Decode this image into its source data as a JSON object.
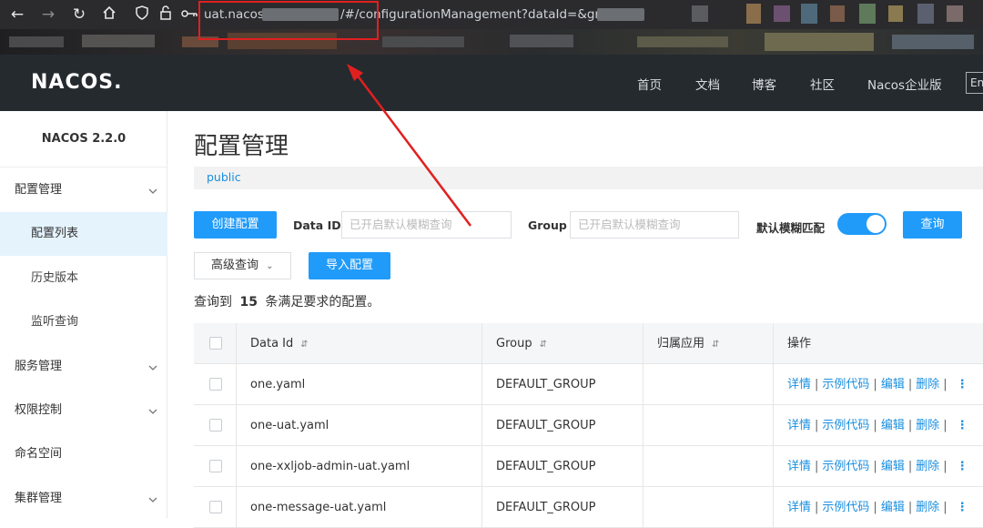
{
  "browser": {
    "url_prefix": "uat.nacos",
    "url_suffix": "/#/configurationManagement?dataId=&grou"
  },
  "header": {
    "logo": "NACOS.",
    "nav": [
      "首页",
      "文档",
      "博客",
      "社区",
      "Nacos企业版"
    ],
    "lang": "En"
  },
  "sidebar": {
    "version": "NACOS 2.2.0",
    "groups": {
      "config": "配置管理",
      "service": "服务管理",
      "auth": "权限控制",
      "namespace": "命名空间",
      "cluster": "集群管理"
    },
    "sub": {
      "list": "配置列表",
      "history": "历史版本",
      "listen": "监听查询"
    }
  },
  "main": {
    "title": "配置管理",
    "namespace": "public",
    "create_label": "创建配置",
    "dataid_label": "Data ID",
    "dataid_placeholder": "已开启默认模糊查询",
    "group_label": "Group",
    "group_placeholder": "已开启默认模糊查询",
    "fuzzy_label": "默认模糊匹配",
    "fuzzy_on": true,
    "search_label": "查询",
    "advanced_label": "高级查询",
    "import_label": "导入配置",
    "result_prefix": "查询到",
    "result_count": "15",
    "result_suffix": "条满足要求的配置。"
  },
  "table": {
    "headers": {
      "dataid": "Data Id",
      "group": "Group",
      "app": "归属应用",
      "ops": "操作"
    },
    "ops": {
      "detail": "详情",
      "sample": "示例代码",
      "edit": "编辑",
      "delete": "删除"
    },
    "rows": [
      {
        "dataid": "one.yaml",
        "group": "DEFAULT_GROUP",
        "app": ""
      },
      {
        "dataid": "one-uat.yaml",
        "group": "DEFAULT_GROUP",
        "app": ""
      },
      {
        "dataid": "one-xxljob-admin-uat.yaml",
        "group": "DEFAULT_GROUP",
        "app": ""
      },
      {
        "dataid": "one-message-uat.yaml",
        "group": "DEFAULT_GROUP",
        "app": ""
      }
    ]
  },
  "colors": {
    "accent": "#209bfa",
    "link": "#1a8fe0",
    "header_bg": "#252a2f",
    "annotation": "#e02020"
  }
}
